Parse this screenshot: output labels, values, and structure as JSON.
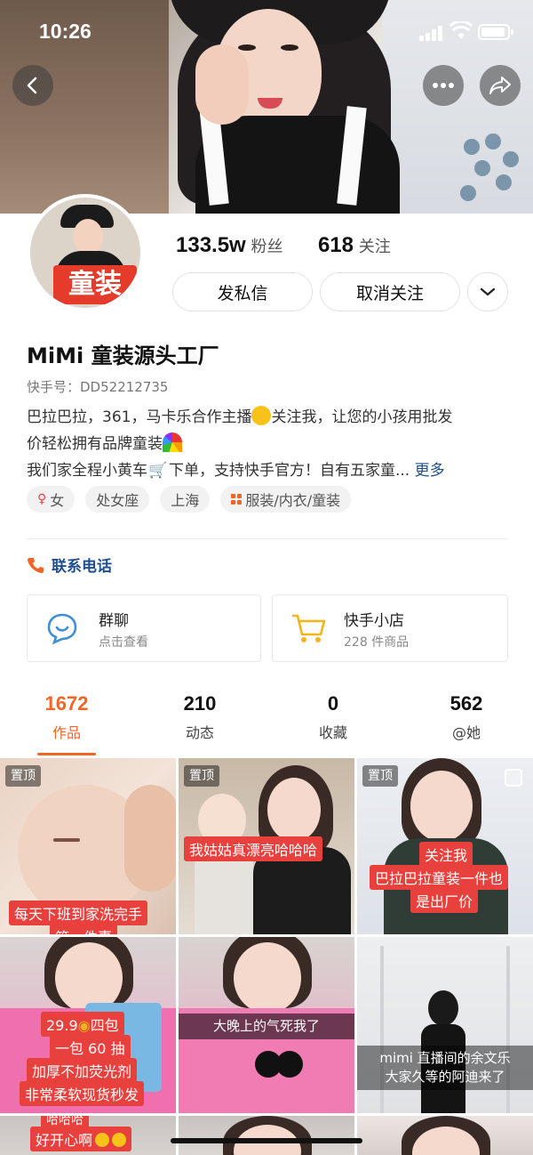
{
  "status": {
    "time": "10:26"
  },
  "profile": {
    "avatar_tag": "童装",
    "followers": "133.5w",
    "followers_label": "粉丝",
    "following": "618",
    "following_label": "关注",
    "message_btn": "发私信",
    "unfollow_btn": "取消关注",
    "name": "MiMi 童装源头工厂",
    "kuaishou_id": "快手号：DD52212735",
    "bio_line1_a": "巴拉巴拉，361，马卡乐合作主播",
    "bio_line1_b": "关注我，让您的小孩用批发",
    "bio_line2": "价轻松拥有品牌童装",
    "bio_line3_a": "我们家全程小黄车",
    "bio_line3_b": "下单，支持快手官方！自有五家童...",
    "more": "更多",
    "tags": [
      "女",
      "处女座",
      "上海",
      "服装/内衣/童装"
    ],
    "phone": "联系电话",
    "group_title": "群聊",
    "group_sub": "点击查看",
    "shop_title": "快手小店",
    "shop_sub": "228 件商品"
  },
  "tabs": [
    {
      "count": "1672",
      "label": "作品"
    },
    {
      "count": "210",
      "label": "动态"
    },
    {
      "count": "0",
      "label": "收藏"
    },
    {
      "count": "562",
      "label": "@她"
    }
  ],
  "videos": {
    "pinned": "置顶",
    "v1": "每天下班到家洗完手",
    "v1b": "第一件事",
    "v2": "我姑姑真漂亮哈哈哈",
    "v3a": "关注我",
    "v3b": "巴拉巴拉童装一件也",
    "v3c": "是出厂价",
    "v4a": "29.9",
    "v4a2": "四包",
    "v4b": "一包 60 抽",
    "v4c": "加厚不加荧光剂",
    "v4d": "非常柔软现货秒发",
    "v5": "大晚上的气死我了",
    "v6a": "mimi 直播间的余文乐",
    "v6b": "大家久等的阿迪来了",
    "v7a": "哈哈哈",
    "v7b": "好开心啊"
  }
}
